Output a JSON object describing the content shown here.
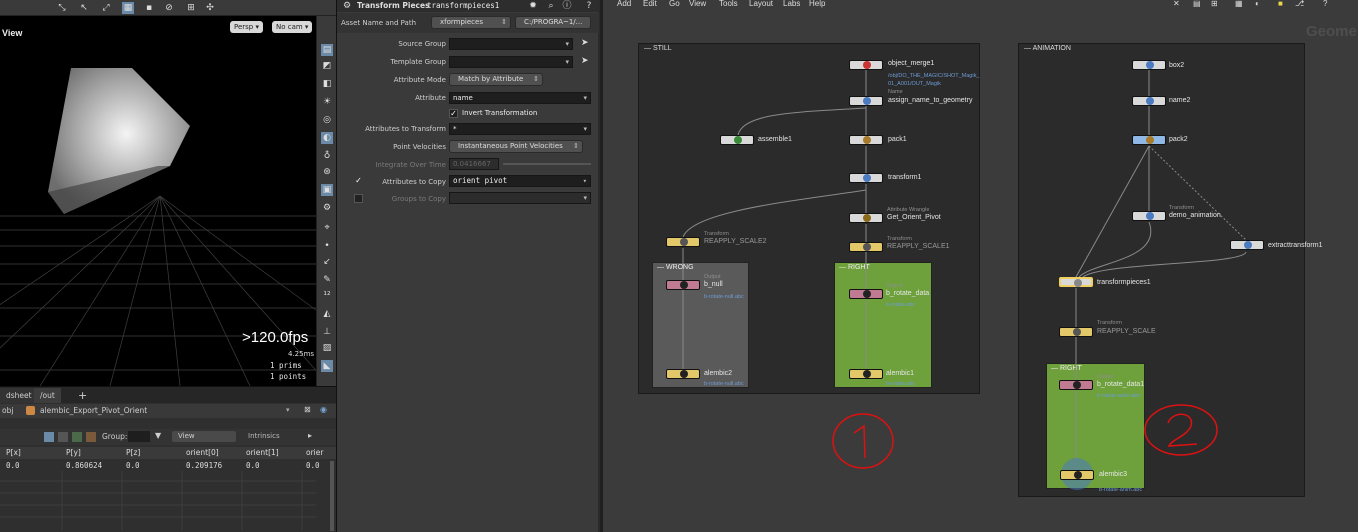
{
  "viewport": {
    "title": "View",
    "persp_label": "Persp ▾",
    "cam_label": "No cam ▾",
    "fps": ">120.0fps",
    "ms": "4.25ms",
    "prims": "1  prims",
    "points": "1 points"
  },
  "spreadsheet": {
    "tab1": "dsheet",
    "tab2": "/out",
    "tab_add": "+",
    "path_ctx": "obj",
    "path_node": "alembic_Export_Pivot_Orient",
    "group_label": "Group:",
    "view_label": "View",
    "intrinsics_label": "Intrinsics",
    "columns": [
      "P[x]",
      "P[y]",
      "P[z]",
      "orient[0]",
      "orient[1]",
      "orier"
    ],
    "row": [
      "0.0",
      "0.860624",
      "0.0",
      "0.209176",
      "0.0",
      "0.0"
    ]
  },
  "params": {
    "node_type": "Transform Pieces",
    "node_name": "transformpieces1",
    "asset_label": "Asset Name and Path",
    "asset_name": "xformpieces",
    "asset_path": "C:/PROGRA~1/...",
    "rows": [
      {
        "label": "Source Group",
        "value": ""
      },
      {
        "label": "Template Group",
        "value": ""
      },
      {
        "label": "Attribute Mode",
        "value": "Match by Attribute"
      },
      {
        "label": "Attribute",
        "value": "name"
      },
      {
        "label": "Invert Transformation",
        "value": ""
      },
      {
        "label": "Attributes to Transform",
        "value": "*"
      },
      {
        "label": "Point Velocities",
        "value": "Instantaneous Point Velocities"
      },
      {
        "label": "Integrate Over Time",
        "value": "0.0416667"
      },
      {
        "label": "Attributes to Copy",
        "value": "orient pivot"
      },
      {
        "label": "Groups to Copy",
        "value": ""
      }
    ]
  },
  "network": {
    "menu": [
      "Add",
      "Edit",
      "Go",
      "View",
      "Tools",
      "Layout",
      "Labs",
      "Help"
    ],
    "watermark": "Geome",
    "still": {
      "title": "STILL",
      "object_merge": "object_merge1",
      "object_merge_path1": "/obj/DO_THE_MAGIC/SHOT_Magik_",
      "object_merge_path2": "01_A001/OUT_Magik",
      "name_sub": "Name",
      "assign_name": "assign_name_to_geometry",
      "assemble": "assemble1",
      "pack": "pack1",
      "transform": "transform1",
      "wrangle_sub": "Attribute Wrangle",
      "get_orient": "Get_Orient_Pivot",
      "transform_sub": "Transform",
      "reapply_scale1": "REAPPLY_SCALE1",
      "reapply_scale2": "REAPPLY_SCALE2",
      "wrong_box": "WRONG",
      "right_box": "RIGHT",
      "output_sub": "Output",
      "b_null": "b_null",
      "b_null_file": "b-rotate-null.abc",
      "b_rotate_data": "b_rotate_data",
      "b_rotate_file": "b-rotate.abc",
      "alembic2": "alembic2",
      "alembic2_file": "b-rotate-null.abc",
      "alembic1": "alembic1",
      "alembic1_file": "b-rotate.abc"
    },
    "anim": {
      "title": "ANIMATION",
      "box": "box2",
      "name": "name2",
      "pack": "pack2",
      "transform_sub": "Transform",
      "demo_anim": "demo_animation",
      "extract": "extracttransform1",
      "tpieces": "transformpieces1",
      "transform_sub2": "Transform",
      "reapply_scale": "REAPPLY_SCALE",
      "right_box": "RIGHT",
      "output_sub": "Output",
      "b_rotate_data": "b_rotate_data1",
      "b_rotate_file": "b-rotate-anim.abc",
      "alembic3": "alembic3",
      "alembic3_file": "b-rotate-anim.abc"
    }
  },
  "colors": {
    "still_right": "#6ea13c",
    "wrong_gray": "#5a5a5a",
    "annotation": "#dd1111"
  }
}
